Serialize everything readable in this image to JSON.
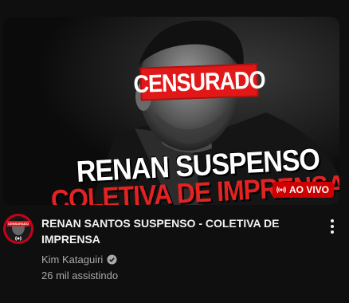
{
  "thumbnail": {
    "censor_text": "CENSURADO",
    "headline_line1": "RENAN SUSPENSO",
    "headline_line2": "COLETIVA DE IMPRENSA",
    "live_badge": "AO VIVO"
  },
  "video": {
    "title": "RENAN SANTOS SUSPENSO - COLETIVA DE IMPRENSA",
    "channel": "Kim Kataguiri",
    "viewers": "26 mil assistindo"
  },
  "avatar": {
    "tag_text": "CENSURADO"
  },
  "colors": {
    "accent_red": "#e21818",
    "live_red": "#cc0000",
    "meta_gray": "#aaaaaa"
  },
  "icons": [
    "live-broadcast-icon",
    "verified-check-icon",
    "more-vert-icon"
  ]
}
